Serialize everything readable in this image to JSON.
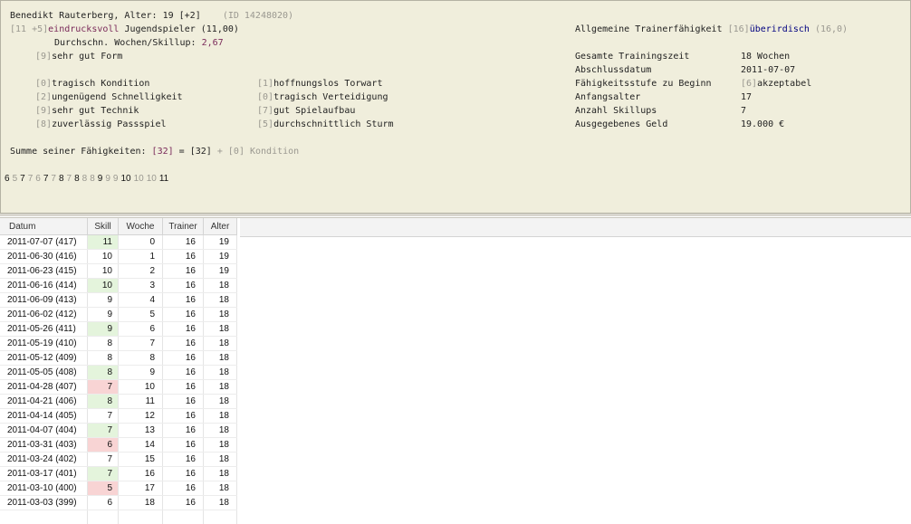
{
  "header": {
    "name_line": "Benedikt Rauterberg, Alter: 19 [+2]",
    "id": "(ID 14248020)",
    "talent_prefix": "[11 +5]",
    "talent_word": "eindrucksvoll",
    "talent_rest": "Jugendspieler (11,00)",
    "weeks_label": "Durchschn. Wochen/Skillup:",
    "weeks_value": "2,67",
    "form_prefix": "[9]",
    "form_text": "sehr gut Form"
  },
  "skills": [
    {
      "level": "[0]",
      "text": "tragisch Kondition"
    },
    {
      "level": "[1]",
      "text": "hoffnungslos Torwart"
    },
    {
      "level": "[2]",
      "text": "ungenügend Schnelligkeit"
    },
    {
      "level": "[0]",
      "text": "tragisch Verteidigung"
    },
    {
      "level": "[9]",
      "text": "sehr gut Technik"
    },
    {
      "level": "[7]",
      "text": "gut Spielaufbau"
    },
    {
      "level": "[8]",
      "text": "zuverlässig Passspiel"
    },
    {
      "level": "[5]",
      "text": "durchschnittlich Sturm"
    }
  ],
  "trainer": {
    "label": "Allgemeine Trainerfähigkeit",
    "level": "[16]",
    "word": "überirdisch",
    "value": "(16,0)"
  },
  "stats": [
    {
      "label": "Gesamte Trainingszeit",
      "value": "18 Wochen"
    },
    {
      "label": "Abschlussdatum",
      "value": "2011-07-07"
    },
    {
      "label": "Fähigkeitsstufe zu Beginn",
      "value_prefix": "[6]",
      "value": "akzeptabel"
    },
    {
      "label": "Anfangsalter",
      "value": "17"
    },
    {
      "label": "Anzahl Skillups",
      "value": "7"
    },
    {
      "label": "Ausgegebenes Geld",
      "value": "19.000 €"
    }
  ],
  "sum": {
    "label": "Summe seiner Fähigkeiten:",
    "a": "[32]",
    "eq": "=",
    "b": "[32]",
    "plus": "+ [0] Kondition"
  },
  "sequence": [
    "6",
    "5",
    "7",
    "7",
    "6",
    "7",
    "7",
    "8",
    "7",
    "8",
    "8",
    "8",
    "9",
    "9",
    "9",
    "10",
    "10",
    "10",
    "11"
  ],
  "table": {
    "headers": [
      "Datum",
      "Skill",
      "Woche",
      "Trainer",
      "Alter"
    ],
    "rows": [
      {
        "date": "2011-07-07 (417)",
        "skill": "11",
        "week": "0",
        "trainer": "16",
        "age": "19",
        "mark": "up"
      },
      {
        "date": "2011-06-30 (416)",
        "skill": "10",
        "week": "1",
        "trainer": "16",
        "age": "19",
        "mark": ""
      },
      {
        "date": "2011-06-23 (415)",
        "skill": "10",
        "week": "2",
        "trainer": "16",
        "age": "19",
        "mark": ""
      },
      {
        "date": "2011-06-16 (414)",
        "skill": "10",
        "week": "3",
        "trainer": "16",
        "age": "18",
        "mark": "up"
      },
      {
        "date": "2011-06-09 (413)",
        "skill": "9",
        "week": "4",
        "trainer": "16",
        "age": "18",
        "mark": ""
      },
      {
        "date": "2011-06-02 (412)",
        "skill": "9",
        "week": "5",
        "trainer": "16",
        "age": "18",
        "mark": ""
      },
      {
        "date": "2011-05-26 (411)",
        "skill": "9",
        "week": "6",
        "trainer": "16",
        "age": "18",
        "mark": "up"
      },
      {
        "date": "2011-05-19 (410)",
        "skill": "8",
        "week": "7",
        "trainer": "16",
        "age": "18",
        "mark": ""
      },
      {
        "date": "2011-05-12 (409)",
        "skill": "8",
        "week": "8",
        "trainer": "16",
        "age": "18",
        "mark": ""
      },
      {
        "date": "2011-05-05 (408)",
        "skill": "8",
        "week": "9",
        "trainer": "16",
        "age": "18",
        "mark": "up"
      },
      {
        "date": "2011-04-28 (407)",
        "skill": "7",
        "week": "10",
        "trainer": "16",
        "age": "18",
        "mark": "down"
      },
      {
        "date": "2011-04-21 (406)",
        "skill": "8",
        "week": "11",
        "trainer": "16",
        "age": "18",
        "mark": "up"
      },
      {
        "date": "2011-04-14 (405)",
        "skill": "7",
        "week": "12",
        "trainer": "16",
        "age": "18",
        "mark": ""
      },
      {
        "date": "2011-04-07 (404)",
        "skill": "7",
        "week": "13",
        "trainer": "16",
        "age": "18",
        "mark": "up"
      },
      {
        "date": "2011-03-31 (403)",
        "skill": "6",
        "week": "14",
        "trainer": "16",
        "age": "18",
        "mark": "down"
      },
      {
        "date": "2011-03-24 (402)",
        "skill": "7",
        "week": "15",
        "trainer": "16",
        "age": "18",
        "mark": ""
      },
      {
        "date": "2011-03-17 (401)",
        "skill": "7",
        "week": "16",
        "trainer": "16",
        "age": "18",
        "mark": "up"
      },
      {
        "date": "2011-03-10 (400)",
        "skill": "5",
        "week": "17",
        "trainer": "16",
        "age": "18",
        "mark": "down"
      },
      {
        "date": "2011-03-03 (399)",
        "skill": "6",
        "week": "18",
        "trainer": "16",
        "age": "18",
        "mark": ""
      }
    ]
  },
  "colors": {
    "panel_bg": "#f0eedc",
    "skill_up": "#e4f4dc",
    "skill_down": "#f8d4d4",
    "purple": "#7a2a5a",
    "blue": "#000080"
  }
}
